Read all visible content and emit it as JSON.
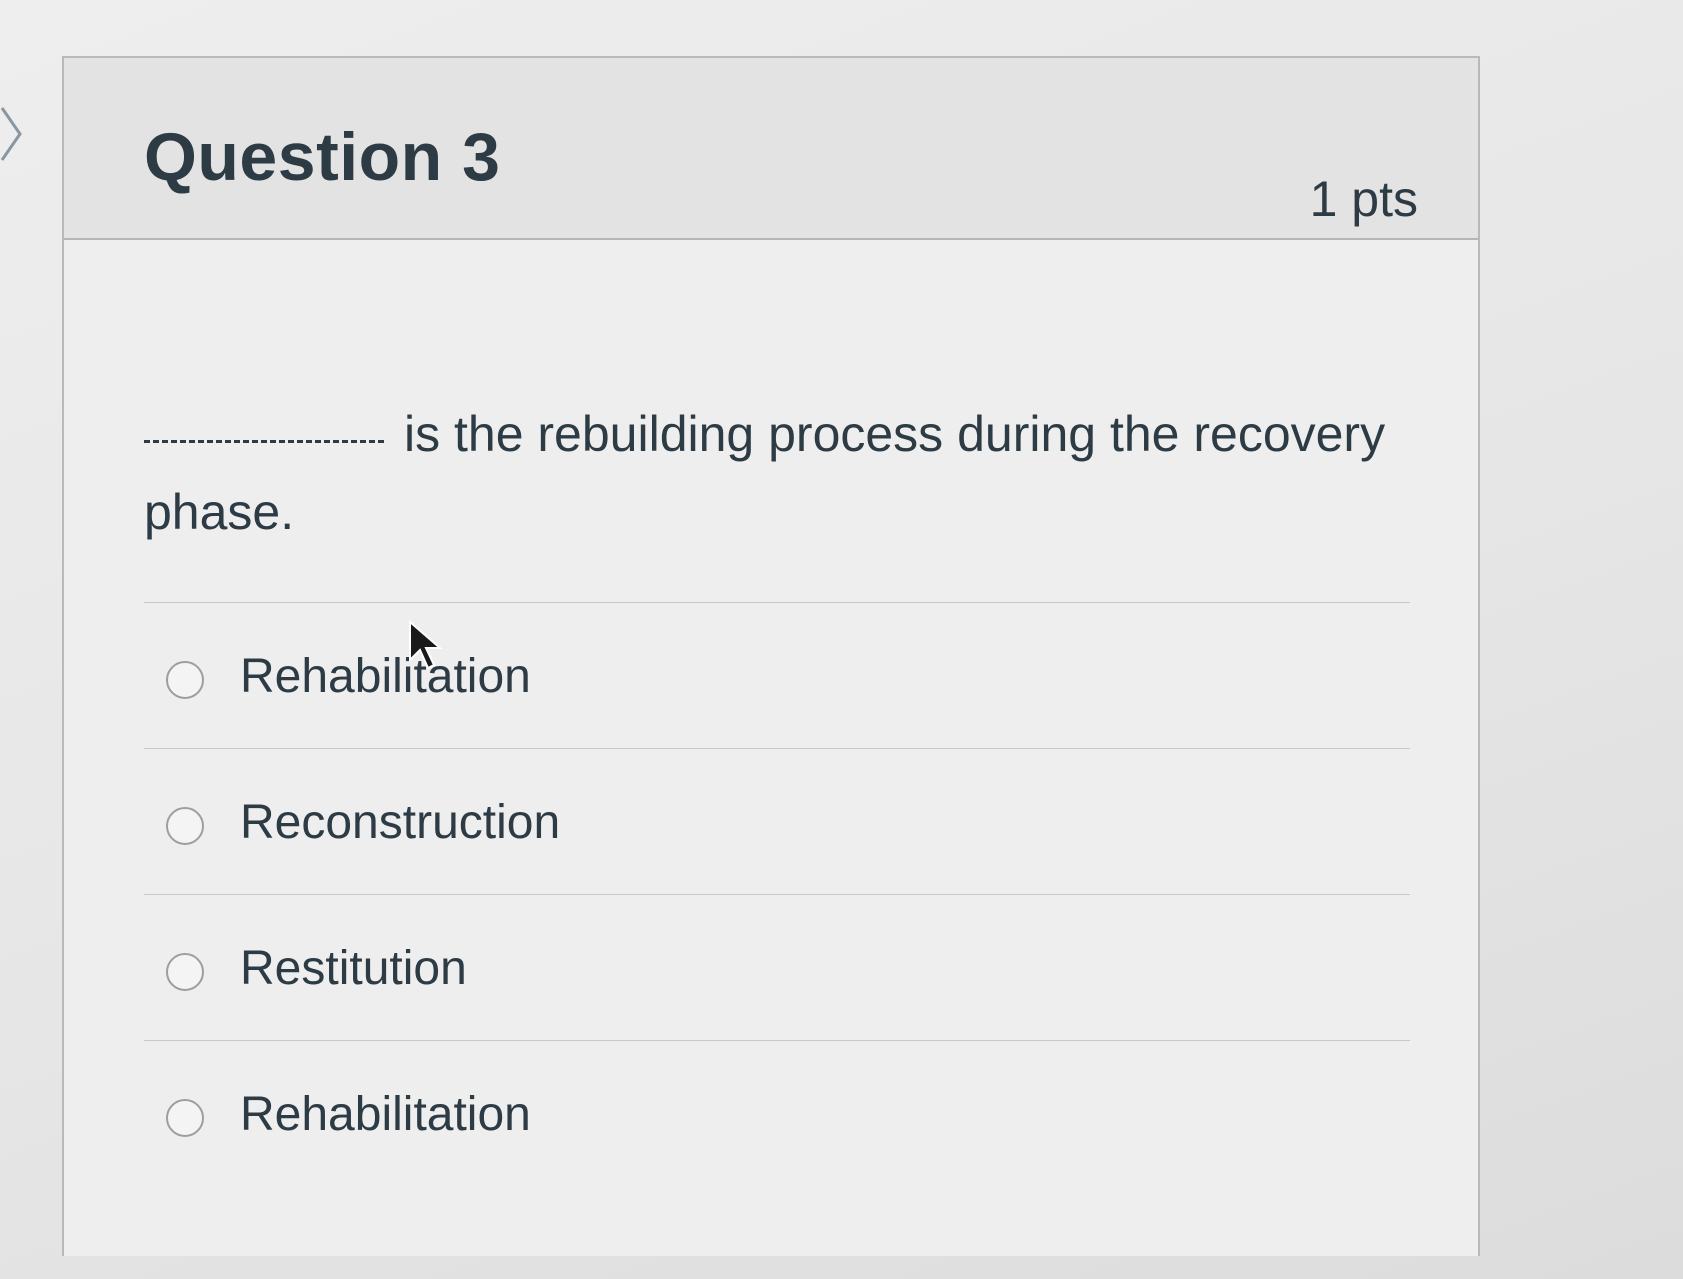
{
  "question": {
    "title": "Question 3",
    "points": "1 pts",
    "text": "is the rebuilding process during the recovery phase."
  },
  "answers": [
    {
      "label": "Rehabilitation",
      "selected": false
    },
    {
      "label": "Reconstruction",
      "selected": false
    },
    {
      "label": "Restitution",
      "selected": false
    },
    {
      "label": "Rehabilitation",
      "selected": false
    }
  ],
  "icons": {
    "collapse": "chevron-right-icon",
    "pointer": "mouse-cursor-icon"
  }
}
